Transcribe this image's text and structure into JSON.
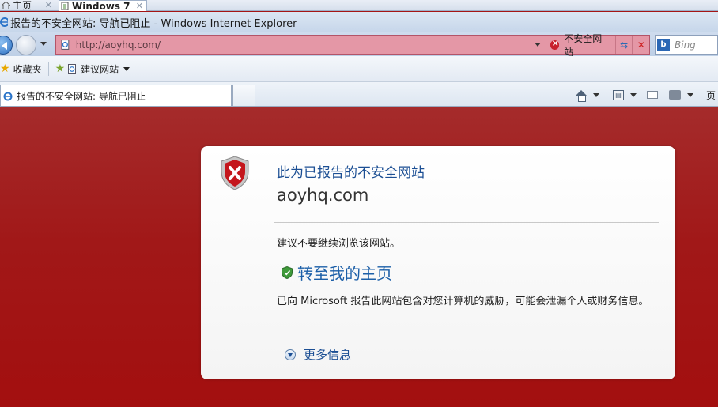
{
  "host_tabs": [
    {
      "label": "主页"
    },
    {
      "label": "Windows 7"
    }
  ],
  "window": {
    "title": "报告的不安全网站: 导航已阻止 - Windows Internet Explorer"
  },
  "address_bar": {
    "url": "http://aoyhq.com/",
    "security_status": "不安全网站",
    "bar_color": "#e497a6"
  },
  "search": {
    "placeholder": "Bing"
  },
  "favorites_bar": {
    "favorites_label": "收藏夹",
    "suggested_sites_label": "建议网站"
  },
  "tab": {
    "label": "报告的不安全网站: 导航已阻止"
  },
  "command_bar": {
    "page_label": "页"
  },
  "warning": {
    "heading": "此为已报告的不安全网站",
    "domain": "aoyhq.com",
    "advice": "建议不要继续浏览该网站。",
    "go_home_label": "转至我的主页",
    "description": "已向 Microsoft 报告此网站包含对您计算机的威胁，可能会泄漏个人或财务信息。",
    "more_info_label": "更多信息",
    "background_color": "#a51414",
    "heading_color": "#1c4f94"
  },
  "icons": [
    "home-icon",
    "close-tab-icon",
    "ie-logo-icon",
    "back-icon",
    "forward-icon",
    "page-icon",
    "unsafe-shield-icon",
    "refresh-icon",
    "stop-icon",
    "bing-icon",
    "star-icon",
    "add-favorite-icon",
    "feeds-icon",
    "mail-icon",
    "print-icon",
    "red-shield-icon",
    "green-shield-icon",
    "expand-icon"
  ]
}
